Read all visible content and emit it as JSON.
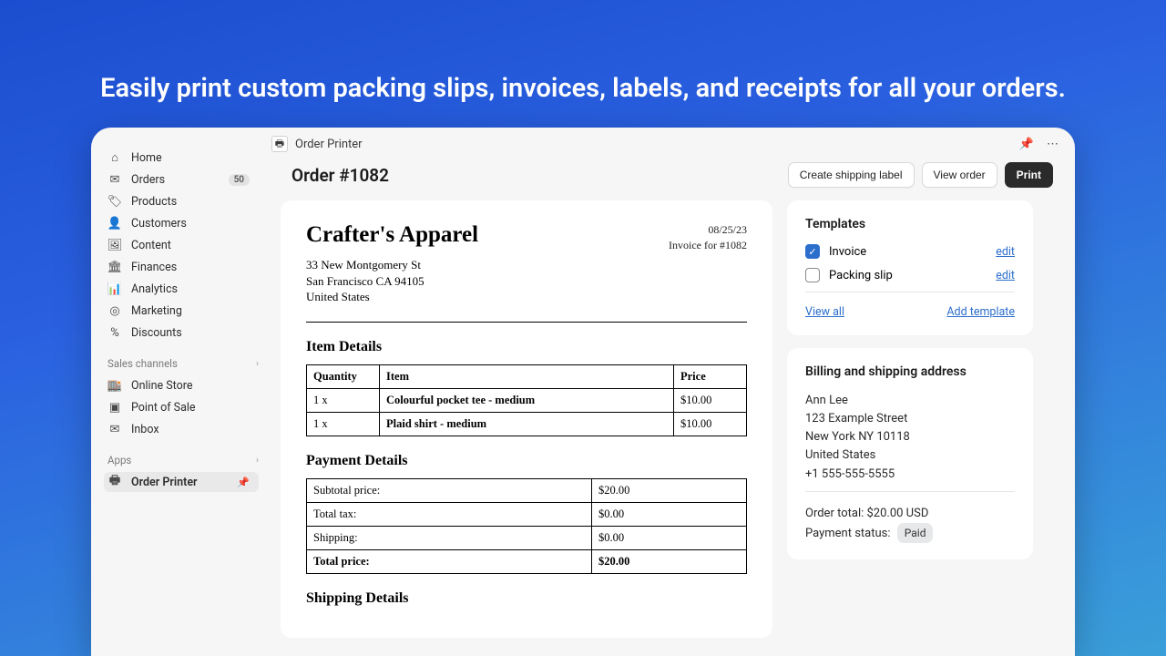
{
  "hero": "Easily print custom packing slips, invoices, labels, and receipts for all your orders.",
  "sidebar": {
    "items": [
      {
        "label": "Home"
      },
      {
        "label": "Orders",
        "badge": "50"
      },
      {
        "label": "Products"
      },
      {
        "label": "Customers"
      },
      {
        "label": "Content"
      },
      {
        "label": "Finances"
      },
      {
        "label": "Analytics"
      },
      {
        "label": "Marketing"
      },
      {
        "label": "Discounts"
      }
    ],
    "channels_header": "Sales channels",
    "channels": [
      {
        "label": "Online Store"
      },
      {
        "label": "Point of Sale"
      },
      {
        "label": "Inbox"
      }
    ],
    "apps_header": "Apps",
    "apps": [
      {
        "label": "Order Printer"
      }
    ]
  },
  "topbar": {
    "app_name": "Order Printer"
  },
  "header": {
    "title": "Order #1082",
    "create_label": "Create shipping label",
    "view_label": "View order",
    "print_label": "Print"
  },
  "invoice": {
    "store": "Crafter's Apparel",
    "date": "08/25/23",
    "subtitle": "Invoice for #1082",
    "address": [
      "33 New Montgomery St",
      "San Francisco CA 94105",
      "United States"
    ],
    "item_header": "Item Details",
    "cols": {
      "qty": "Quantity",
      "item": "Item",
      "price": "Price"
    },
    "items": [
      {
        "qty": "1 x",
        "name": "Colourful pocket tee - medium",
        "price": "$10.00"
      },
      {
        "qty": "1 x",
        "name": "Plaid shirt - medium",
        "price": "$10.00"
      }
    ],
    "payment_header": "Payment Details",
    "payment": [
      {
        "label": "Subtotal price:",
        "value": "$20.00"
      },
      {
        "label": "Total tax:",
        "value": "$0.00"
      },
      {
        "label": "Shipping:",
        "value": "$0.00"
      },
      {
        "label": "Total price:",
        "value": "$20.00",
        "bold": true
      }
    ],
    "shipping_header": "Shipping Details"
  },
  "templates": {
    "title": "Templates",
    "items": [
      {
        "label": "Invoice",
        "checked": true
      },
      {
        "label": "Packing slip",
        "checked": false
      }
    ],
    "edit": "edit",
    "view_all": "View all",
    "add": "Add template"
  },
  "billing": {
    "title": "Billing and shipping address",
    "name": "Ann Lee",
    "street": "123 Example Street",
    "city": "New York NY 10118",
    "country": "United States",
    "phone": "+1 555-555-5555",
    "order_total_label": "Order total:",
    "order_total_value": "$20.00 USD",
    "payment_status_label": "Payment status:",
    "payment_status_value": "Paid"
  }
}
